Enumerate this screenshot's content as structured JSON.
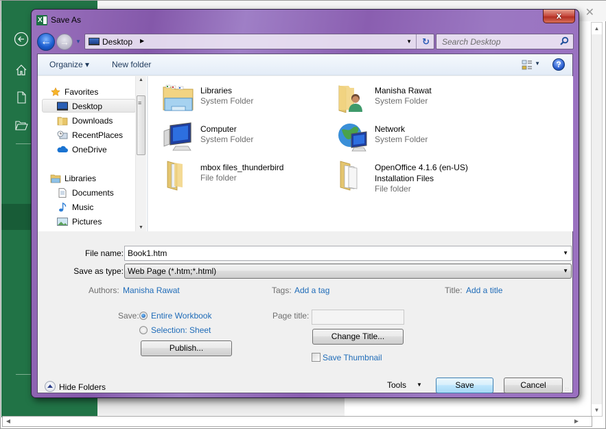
{
  "excel": {
    "rail_icons": [
      "back-arrow",
      "home",
      "new-document",
      "open-folder"
    ],
    "close_glyph": "✕"
  },
  "dialog": {
    "title": "Save As",
    "app_icon_letter": "X",
    "close_glyph": "x",
    "nav": {
      "back_glyph": "←",
      "forward_glyph": "→",
      "recent_glyph": "▼"
    },
    "address": {
      "location": "Desktop",
      "separator_glyph": "▶",
      "dropdown_glyph": "▼",
      "refresh_glyph": "↻"
    },
    "search": {
      "placeholder": "Search Desktop"
    },
    "toolbar": {
      "organize_label": "Organize ▾",
      "new_folder_label": "New folder",
      "view_dropdown_glyph": "▼",
      "help_glyph": "?"
    },
    "navpane": {
      "items": [
        {
          "label": "Favorites",
          "icon": "star-icon",
          "type": "header"
        },
        {
          "label": "Desktop",
          "icon": "desktop-icon",
          "type": "item",
          "selected": true
        },
        {
          "label": "Downloads",
          "icon": "folder-icon",
          "type": "item"
        },
        {
          "label": "RecentPlaces",
          "icon": "recent-places-icon",
          "type": "item"
        },
        {
          "label": "OneDrive",
          "icon": "cloud-icon",
          "type": "item"
        },
        {
          "label": "Libraries",
          "icon": "libraries-icon",
          "type": "header"
        },
        {
          "label": "Documents",
          "icon": "document-icon",
          "type": "item"
        },
        {
          "label": "Music",
          "icon": "music-note-icon",
          "type": "item"
        },
        {
          "label": "Pictures",
          "icon": "picture-icon",
          "type": "item"
        }
      ]
    },
    "files": [
      {
        "name": "Libraries",
        "type": "System Folder",
        "icon": "libraries-folder-icon"
      },
      {
        "name": "Manisha Rawat",
        "type": "System Folder",
        "icon": "user-folder-icon"
      },
      {
        "name": "Computer",
        "type": "System Folder",
        "icon": "computer-icon"
      },
      {
        "name": "Network",
        "type": "System Folder",
        "icon": "network-icon"
      },
      {
        "name": "mbox files_thunderbird",
        "type": "File folder",
        "icon": "folder-icon"
      },
      {
        "name": "OpenOffice 4.1.6 (en-US) Installation Files",
        "name_line1": "OpenOffice 4.1.6 (en-US)",
        "name_line2": "Installation Files",
        "type": "File folder",
        "icon": "folder-icon"
      }
    ],
    "form": {
      "file_name_label": "File name:",
      "file_name_value": "Book1.htm",
      "save_type_label": "Save as type:",
      "save_type_value": "Web Page (*.htm;*.html)",
      "authors_label": "Authors:",
      "authors_value": "Manisha Rawat",
      "tags_label": "Tags:",
      "tags_value": "Add a tag",
      "title_label": "Title:",
      "title_value": "Add a title",
      "save_label": "Save:",
      "save_options": [
        {
          "label": "Entire Workbook",
          "checked": true
        },
        {
          "label": "Selection: Sheet",
          "checked": false
        }
      ],
      "publish_label": "Publish...",
      "page_title_label": "Page title:",
      "page_title_value": "",
      "change_title_label": "Change Title...",
      "save_thumbnail_label": "Save Thumbnail",
      "save_thumbnail_checked": false
    },
    "footer": {
      "hide_folders_label": "Hide Folders",
      "tools_label": "Tools",
      "tools_glyph": "▼",
      "save_button": "Save",
      "cancel_button": "Cancel"
    }
  }
}
